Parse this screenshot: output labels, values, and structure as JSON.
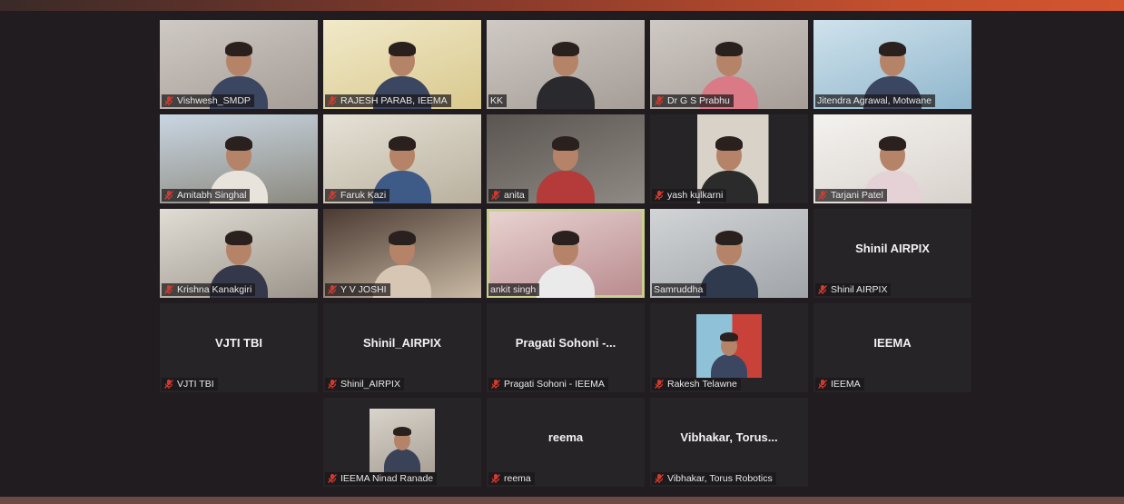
{
  "participants": [
    {
      "name": "Vishwesh_SMDP",
      "type": "video"
    },
    {
      "name": "RAJESH PARAB, IEEMA",
      "type": "video"
    },
    {
      "name": "KK",
      "type": "video"
    },
    {
      "name": "Dr G S Prabhu",
      "type": "video"
    },
    {
      "name": "Jitendra Agrawal, Motwane",
      "type": "video"
    },
    {
      "name": "Amitabh Singhal",
      "type": "video"
    },
    {
      "name": "Faruk Kazi",
      "type": "video"
    },
    {
      "name": "anita",
      "type": "video"
    },
    {
      "name": "yash kulkarni",
      "type": "video"
    },
    {
      "name": "Tarjani Patel",
      "type": "video"
    },
    {
      "name": "Krishna Kanakgiri",
      "type": "video"
    },
    {
      "name": "Y V JOSHI",
      "type": "video"
    },
    {
      "name": "ankit singh",
      "type": "video",
      "active": true
    },
    {
      "name": "Samruddha",
      "type": "video"
    },
    {
      "name": "Shinil AIRPIX",
      "type": "name",
      "display": "Shinil AIRPIX"
    },
    {
      "name": "VJTI TBI",
      "type": "name",
      "display": "VJTI TBI"
    },
    {
      "name": "Shinil_AIRPIX",
      "type": "name",
      "display": "Shinil_AIRPIX"
    },
    {
      "name": "Pragati Sohoni - IEEMA",
      "type": "name",
      "display": "Pragati Sohoni -..."
    },
    {
      "name": "Rakesh Telawne",
      "type": "photo"
    },
    {
      "name": "IEEMA",
      "type": "name",
      "display": "IEEMA"
    },
    {
      "name": "IEEMA Ninad Ranade",
      "type": "photo"
    },
    {
      "name": "reema",
      "type": "name",
      "display": "reema"
    },
    {
      "name": "Vibhakar, Torus Robotics",
      "type": "name",
      "display": "Vibhakar,  Torus..."
    }
  ],
  "colors": {
    "background": "#201c20",
    "active_outline": "#c7d08c",
    "muted_mic": "#d23a2e"
  },
  "icons": {
    "mic": "microphone-muted-icon"
  }
}
